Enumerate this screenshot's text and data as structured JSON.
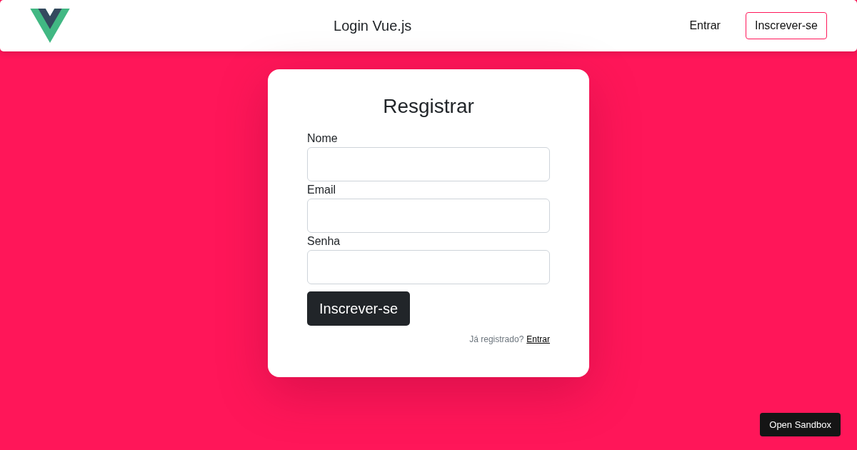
{
  "navbar": {
    "title": "Login Vue.js",
    "links": [
      {
        "label": "Entrar",
        "kind": "link"
      },
      {
        "label": "Inscrever-se",
        "kind": "outlined"
      }
    ]
  },
  "form": {
    "heading": "Resgistrar",
    "fields": [
      {
        "label": "Nome"
      },
      {
        "label": "Email"
      },
      {
        "label": "Senha"
      }
    ],
    "submit": "Inscrever-se",
    "footer": {
      "prompt": "Já registrado?",
      "link": "Entrar"
    }
  },
  "sandbox_button": "Open Sandbox"
}
